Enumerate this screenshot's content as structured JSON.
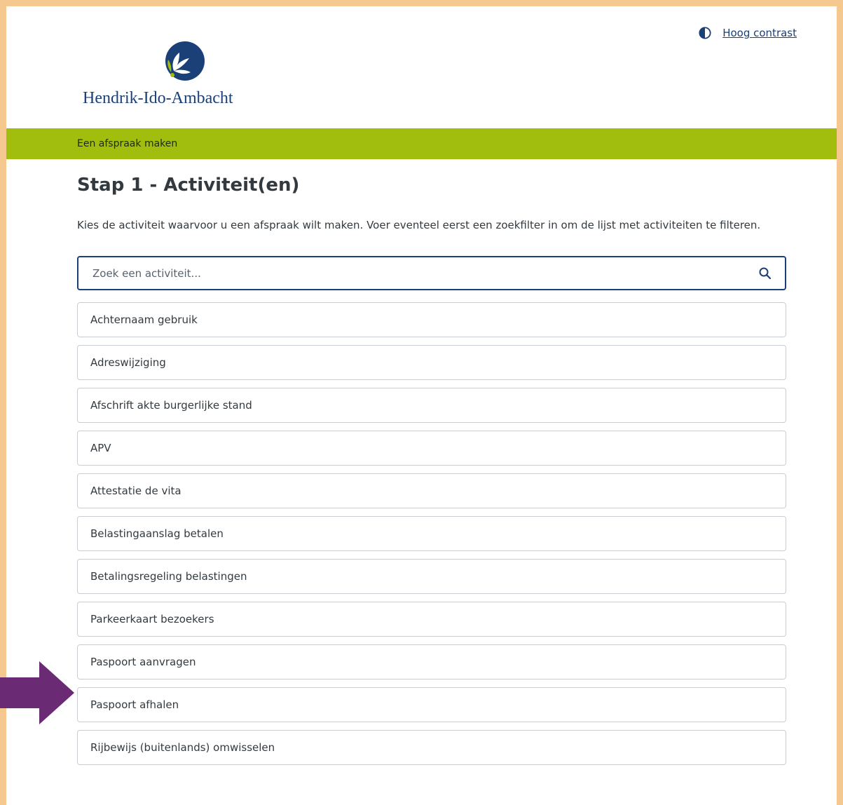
{
  "header": {
    "contrast_link": "Hoog contrast",
    "contrast_icon": "contrast-icon",
    "logo_text": "Hendrik-Ido-Ambacht"
  },
  "banner": {
    "label": "Een afspraak maken"
  },
  "main": {
    "title": "Stap 1 - Activiteit(en)",
    "intro": "Kies de activiteit waarvoor u een afspraak wilt maken. Voer eventeel eerst een zoekfilter in om de lijst met activiteiten te filteren.",
    "search": {
      "placeholder": "Zoek een activiteit...",
      "value": "",
      "icon": "search-icon"
    },
    "activities": [
      "Achternaam gebruik",
      "Adreswijziging",
      "Afschrift akte burgerlijke stand",
      "APV",
      "Attestatie de vita",
      "Belastingaanslag betalen",
      "Betalingsregeling belastingen",
      "Parkeerkaart bezoekers",
      "Paspoort aanvragen",
      "Paspoort afhalen",
      "Rijbewijs (buitenlands) omwisselen"
    ]
  },
  "annotation": {
    "highlighted_item": "Paspoort aanvragen",
    "arrow_color": "#6b2a74"
  },
  "colors": {
    "frame": "#f5c88f",
    "green_bar": "#a1bd0e",
    "brand_blue": "#1b3f77"
  }
}
